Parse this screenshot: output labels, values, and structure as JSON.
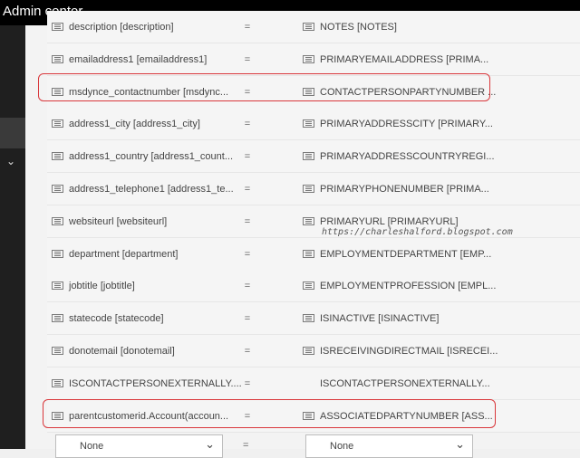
{
  "app": {
    "title": "Admin center"
  },
  "mappings": [
    {
      "source": "description [description]",
      "target": "NOTES [NOTES]",
      "target_has_icon": true
    },
    {
      "source": "emailaddress1 [emailaddress1]",
      "target": "PRIMARYEMAILADDRESS [PRIMA...",
      "target_has_icon": true
    },
    {
      "source": "msdynce_contactnumber [msdync...",
      "target": "CONTACTPERSONPARTYNUMBER ...",
      "target_has_icon": true,
      "highlighted": true
    },
    {
      "source": "address1_city [address1_city]",
      "target": "PRIMARYADDRESSCITY [PRIMARY...",
      "target_has_icon": true
    },
    {
      "source": "address1_country [address1_count...",
      "target": "PRIMARYADDRESSCOUNTRYREGI...",
      "target_has_icon": true
    },
    {
      "source": "address1_telephone1 [address1_te...",
      "target": "PRIMARYPHONENUMBER [PRIMA...",
      "target_has_icon": true
    },
    {
      "source": "websiteurl [websiteurl]",
      "target": "PRIMARYURL [PRIMARYURL]",
      "target_has_icon": true
    },
    {
      "source": "department [department]",
      "target": "EMPLOYMENTDEPARTMENT [EMP...",
      "target_has_icon": true
    },
    {
      "source": "jobtitle [jobtitle]",
      "target": "EMPLOYMENTPROFESSION [EMPL...",
      "target_has_icon": true
    },
    {
      "source": "statecode [statecode]",
      "target": "ISINACTIVE [ISINACTIVE]",
      "target_has_icon": true
    },
    {
      "source": "donotemail [donotemail]",
      "target": "ISRECEIVINGDIRECTMAIL [ISRECEI...",
      "target_has_icon": true
    },
    {
      "source": "ISCONTACTPERSONEXTERNALLY....",
      "target": "ISCONTACTPERSONEXTERNALLY...",
      "target_has_icon": false
    },
    {
      "source": "parentcustomerid.Account(accoun...",
      "target": "ASSOCIATEDPARTYNUMBER [ASS...",
      "target_has_icon": true,
      "highlighted": true
    }
  ],
  "equals_sign": "=",
  "new_row": {
    "source_value": "None",
    "target_value": "None"
  },
  "watermark": "https://charleshalford.blogspot.com",
  "colors": {
    "highlight": "#d9373b",
    "topbar": "#000000",
    "nav": "#1f1f1f"
  }
}
